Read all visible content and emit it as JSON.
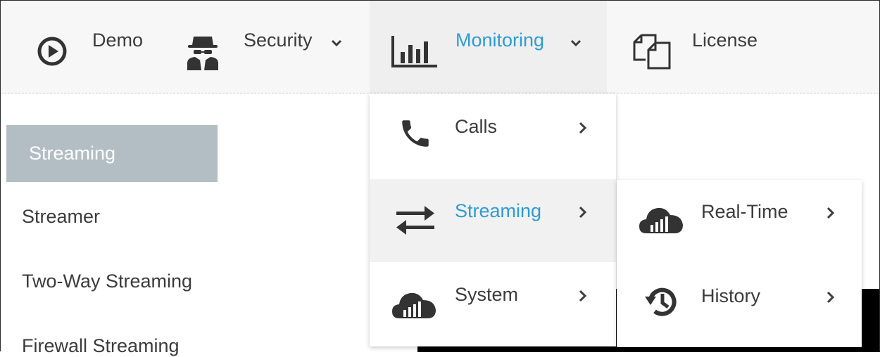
{
  "navbar": {
    "items": [
      {
        "label": "Demo",
        "icon": "play-circle-icon"
      },
      {
        "label": "Security",
        "icon": "spy-icon",
        "chevron": "⌄"
      },
      {
        "label": "Monitoring",
        "icon": "bar-chart-icon",
        "chevron": "⌄",
        "active": true
      },
      {
        "label": "License",
        "icon": "copy-icon"
      }
    ]
  },
  "sidebar": {
    "selected": "Streaming",
    "items": [
      "Streamer",
      "Two-Way Streaming",
      "Firewall Streaming"
    ]
  },
  "monitoring_menu": {
    "items": [
      {
        "label": "Calls",
        "icon": "phone-icon",
        "chevron": "›"
      },
      {
        "label": "Streaming",
        "icon": "exchange-arrows-icon",
        "chevron": "›",
        "active": true
      },
      {
        "label": "System",
        "icon": "cloud-chart-icon",
        "chevron": "›"
      }
    ]
  },
  "streaming_submenu": {
    "items": [
      {
        "label": "Real-Time",
        "icon": "cloud-chart-icon",
        "chevron": "›"
      },
      {
        "label": "History",
        "icon": "history-icon",
        "chevron": "›"
      }
    ]
  },
  "colors": {
    "accent": "#2e9bd6",
    "selected_bg": "#b2bec3",
    "nav_bg": "#f7f7f7",
    "text": "#3c3c3c"
  }
}
